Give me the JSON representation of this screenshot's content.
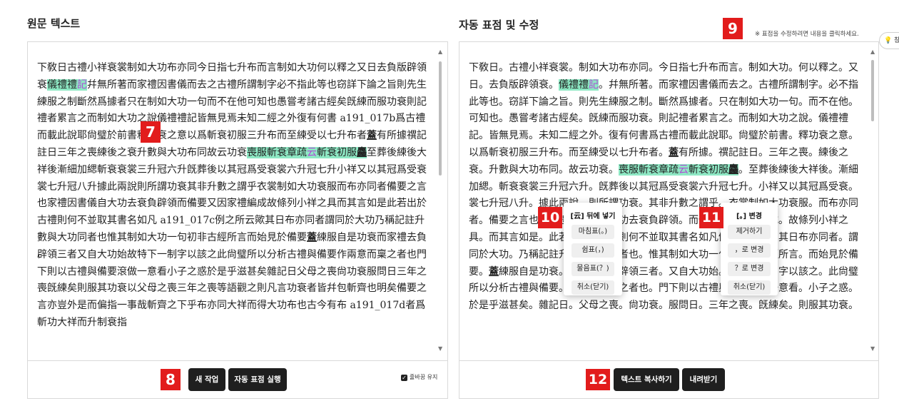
{
  "left": {
    "title": "원문 텍스트",
    "segments": [
      {
        "t": "下敎日古禮小祥衰裳制如大功布亦同今日指七升布而言制如大功何以釋之又日去負版辟領衰"
      },
      {
        "t": "儀禮禮",
        "c": "hl"
      },
      {
        "t": "記",
        "c": "hl pu"
      },
      {
        "t": "幷無所著而家禮因書儀而去之古禮所謂制字必不指此等也窃詳下論之旨則先生練服之制斷然爲據者只在制如大功一句而不在他可知也愚嘗考諸古經矣旣練而服功衰則記禮者累言之而制如大功之說儀禮禮記皆無見焉未知二經之外復有何書 "
      },
      {
        "t": "a191_017b"
      },
      {
        "t": "爲古禮而載此說耶尙璧於前書釋功衰之意以爲斬衰初服三升布而至練受以七升布者"
      },
      {
        "t": "蓋",
        "c": "ul"
      },
      {
        "t": "有所據禩記註日三年之喪練後之衰升數與大功布同故云功衰"
      },
      {
        "t": "喪服斬衰章疏",
        "c": "hl"
      },
      {
        "t": "云",
        "c": "hl pu"
      },
      {
        "t": "斬衰初服",
        "c": "hl"
      },
      {
        "t": "麤",
        "c": "hl ul"
      },
      {
        "t": "至葬後練後大祥後漸細加緦斬衰衰裳三升冠六升旣葬後以其冠爲受衰裳六升冠七升小祥又以其冠爲受衰裳七升冠八升據此兩說則所謂功衰其非升數之謂乎衣裳制如大功衰服而布亦同者備要之言也家禮因書儀自大功去衰負辟領而備要又因家禮編成故條列小祥之具而其言如是此若出於古禮則何不並取其書名如凡 a191_017c例之所云歟其日布亦同者謂同於大功乃稱記註升數與大功同者也惟其制如大功一句初非古經所言而始見於備要"
      },
      {
        "t": "蓋",
        "c": "ul"
      },
      {
        "t": "練服自是功衰而家禮去負辟領三者又自大功始故特下一制字以該之此尙璧所以分析古禮與備要作兩意而稟之者也門下則以古禮與備要滾做一意看小子之惑於是乎滋甚矣雜記日父母之喪尙功衰服問日三年之喪旣練矣則服其功衰以父母之喪三年之喪等語觀之則凡言功衰者皆幷包斬齊也明矣備要之言亦豈外是而偏指一事哉斬齊之下乎布亦同大祥而得大功布也古今有布 a191_017d者爲斬功大祥而升制衰指"
      }
    ],
    "button_new": "새 작업",
    "button_run": "자동 표점 실행",
    "keep_linebreak": "줄바꿈 유지"
  },
  "right": {
    "title": "자동 표점 및 수정",
    "notice": "※ 표점을 수정하려면 내용을 클릭하세요.",
    "segments": [
      {
        "t": "下敎日。古禮小祥衰裳。制如大功布亦同。今日指七升布而言。制如大功。何以釋之。又日。去負版辟領衰。"
      },
      {
        "t": "儀禮禮",
        "c": "hl"
      },
      {
        "t": "記",
        "c": "hl pu"
      },
      {
        "t": "。幷無所著。而家禮因書儀而去之。古禮所謂制字。必不指此等也。窃詳下論之旨。則先生練服之制。斷然爲據者。只在制如大功一句。而不在他。可知也。愚嘗考諸古經矣。旣練而服功衰。則記禮者累言之。而制如大功之說。儀禮禮記。皆無見焉。未知二經之外。復有何書爲古禮而載此說耶。尙璧於前書。釋功衰之意。以爲斬衰初服三升布。而至練受以七升布者。"
      },
      {
        "t": "蓋",
        "c": "ul"
      },
      {
        "t": "有所據。禩記註日。三年之喪。練後之衰。升數與大功布同。故云功衰。"
      },
      {
        "t": "喪服斬衰章疏",
        "c": "hl"
      },
      {
        "t": "云",
        "c": "hl pu"
      },
      {
        "t": "斬衰初服",
        "c": "hl"
      },
      {
        "t": "麤",
        "c": "hl ul"
      },
      {
        "t": "。至葬後練後大祥後。漸細加緦。斬衰衰裳三升冠六升。旣葬後以其冠爲受衰裳六升冠七升。小祥又以其冠爲受衰。裳七升冠八升。據此兩說。則所謂功衰。其非升數之謂乎。衣裳制如大功衰服。而布亦同者。備要之言也。家禮因書儀自大功去衰負辟領。而備要又因家禮編成。故條列小祥之具。而其言如是。此若出於古禮。則何不並取其書名如凡例之所云歟。其日布亦同者。謂同於大功。乃稱記註升數與大功同者也。惟其制如大功一句。初非古經所言。而始見於備要。"
      },
      {
        "t": "蓋",
        "c": "ul"
      },
      {
        "t": "練服自是功衰。而家禮去負辟領三者。又自大功始。故特下一制字以該之。此尙璧所以分析古禮與備要。作兩意而稟之者也。門下則以古禮與備要滾做一意看。小子之惑。於是乎滋甚矣。雜記日。父母之喪。尙功衰。服問日。三年之喪。旣練矣。則服其功衰。"
      }
    ],
    "button_copy": "텍스트 복사하기",
    "button_download": "내려받기"
  },
  "menu_after": {
    "title": "[云] 뒤에 넣기",
    "items": [
      "마침표(。)",
      "쉼표(，)",
      "물음표(？)",
      "취소(닫기)"
    ]
  },
  "menu_change": {
    "title": "[。] 변경",
    "items": [
      "제거하기",
      "，로 변경",
      "？로 변경",
      "취소(닫기)"
    ]
  },
  "badges": [
    "7",
    "8",
    "9",
    "10",
    "11",
    "12"
  ],
  "tip_label": "💡 창"
}
